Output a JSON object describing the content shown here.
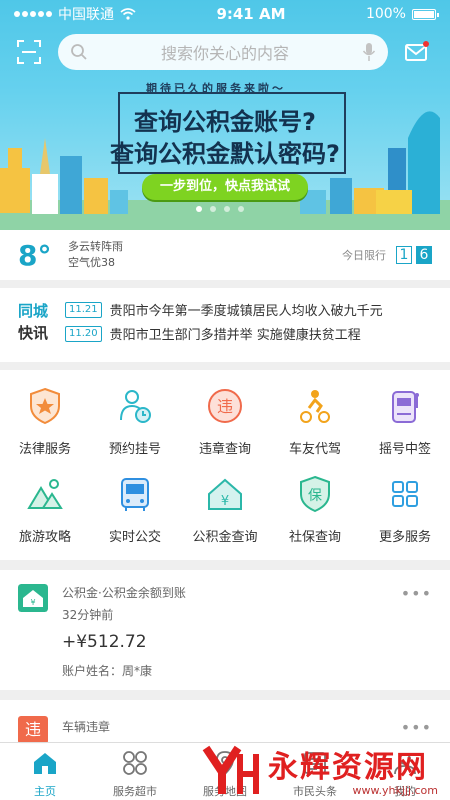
{
  "status_bar": {
    "carrier": "中国联通",
    "time": "9:41 AM",
    "battery": "100%"
  },
  "search": {
    "placeholder": "搜索你关心的内容"
  },
  "banner": {
    "small_text": "期待已久的服务来啦～",
    "line1": "查询公积金账号?",
    "line2": "查询公积金默认密码?",
    "cta": "一步到位，快点我试试",
    "page_count": 4,
    "active_page": 0
  },
  "weather": {
    "temperature": "8°",
    "condition": "多云转阵雨",
    "air": "空气优38",
    "limit_label": "今日限行",
    "limit_numbers": [
      "1",
      "6"
    ]
  },
  "news": {
    "tag_line1": "同城",
    "tag_line2": "快讯",
    "items": [
      {
        "date": "11.21",
        "text": "贵阳市今年第一季度城镇居民人均收入破九千元"
      },
      {
        "date": "11.20",
        "text": "贵阳市卫生部门多措并举 实施健康扶贫工程"
      }
    ]
  },
  "services": [
    {
      "label": "法律服务",
      "icon": "shield-star-icon",
      "color": "#f28c3b"
    },
    {
      "label": "预约挂号",
      "icon": "doctor-clock-icon",
      "color": "#2bb7c9"
    },
    {
      "label": "违章查询",
      "icon": "violation-icon",
      "color": "#f06a4b"
    },
    {
      "label": "车友代驾",
      "icon": "driver-icon",
      "color": "#f2a31b"
    },
    {
      "label": "摇号中签",
      "icon": "slot-machine-icon",
      "color": "#8b6bd6"
    },
    {
      "label": "旅游攻略",
      "icon": "mountain-icon",
      "color": "#2bb78f"
    },
    {
      "label": "实时公交",
      "icon": "bus-icon",
      "color": "#2f8fe0"
    },
    {
      "label": "公积金查询",
      "icon": "house-yen-icon",
      "color": "#2bb7a9"
    },
    {
      "label": "社保查询",
      "icon": "shield-bao-icon",
      "color": "#2bb78f"
    },
    {
      "label": "更多服务",
      "icon": "grid-icon",
      "color": "#2f9fe0"
    }
  ],
  "cards": [
    {
      "title": "公积金·公积金余额到账",
      "time": "32分钟前",
      "amount": "+¥512.72",
      "owner": "账户姓名：周*康",
      "icon_color": "#2bb78f"
    },
    {
      "title": "车辆违章",
      "icon_text": "违",
      "icon_color": "#f06a4b"
    }
  ],
  "tabbar": [
    {
      "label": "主页",
      "icon": "home-icon",
      "active": true
    },
    {
      "label": "服务超市",
      "icon": "services-grid-icon",
      "active": false
    },
    {
      "label": "服务地图",
      "icon": "map-icon",
      "active": false
    },
    {
      "label": "市民头条",
      "icon": "news-icon",
      "active": false
    },
    {
      "label": "我的",
      "icon": "profile-icon",
      "active": false
    }
  ],
  "watermark": {
    "text": "永辉资源网",
    "url": "www.yhkjjj.com"
  },
  "colors": {
    "accent": "#1aa5c7",
    "cta_green": "#7ed321"
  }
}
